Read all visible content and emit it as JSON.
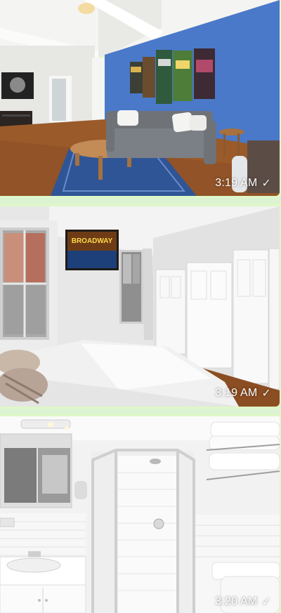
{
  "messages": [
    {
      "time": "3:19 AM",
      "status_icon": "single-check-icon",
      "scene": "living-room"
    },
    {
      "time": "3:19 AM",
      "status_icon": "single-check-icon",
      "scene": "bedroom"
    },
    {
      "time": "3:20 AM",
      "status_icon": "single-check-icon",
      "scene": "bathroom"
    }
  ],
  "photo_text": {
    "bedroom_tv": "BROADWAY"
  },
  "colors": {
    "chat_background": "#dcf3d3",
    "accent_blue_wall": "#4a79c9",
    "floor_wood": "#9a5a2a"
  }
}
